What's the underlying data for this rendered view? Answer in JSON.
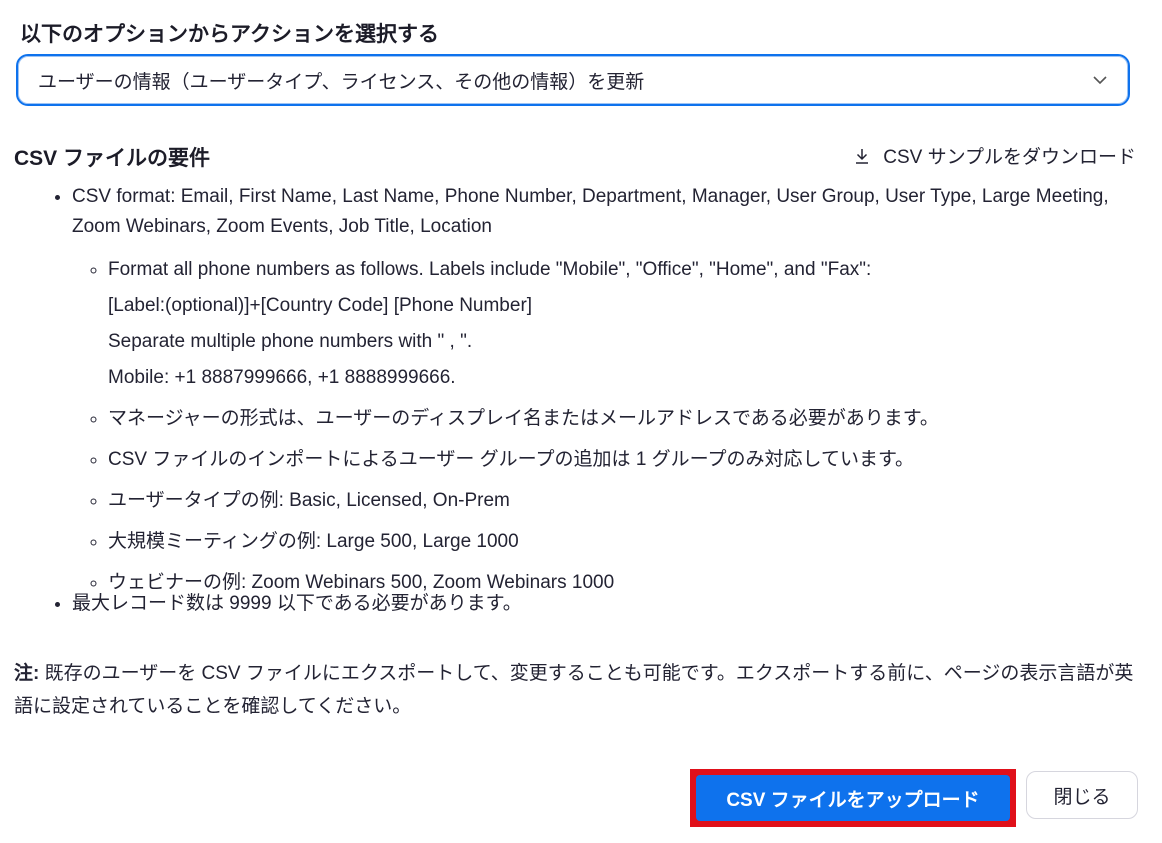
{
  "action": {
    "label": "以下のオプションからアクションを選択する",
    "selected": "ユーザーの情報（ユーザータイプ、ライセンス、その他の情報）を更新"
  },
  "requirements": {
    "title": "CSV ファイルの要件",
    "download_label": "CSV サンプルをダウンロード",
    "csv_format": "CSV format: Email, First Name, Last Name, Phone Number, Department, Manager, User Group, User Type, Large Meeting, Zoom Webinars, Zoom Events, Job Title, Location",
    "phone_lines": [
      "Format all phone numbers as follows. Labels include \"Mobile\", \"Office\", \"Home\", and \"Fax\":",
      "[Label:(optional)]+[Country Code] [Phone Number]",
      "Separate multiple phone numbers with \" , \".",
      "Mobile: +1 8887999666, +1 8888999666."
    ],
    "sub_items": [
      "マネージャーの形式は、ユーザーのディスプレイ名またはメールアドレスである必要があります。",
      "CSV ファイルのインポートによるユーザー グループの追加は 1 グループのみ対応しています。",
      "ユーザータイプの例: Basic, Licensed, On-Prem",
      "大規模ミーティングの例: Large 500, Large 1000",
      "ウェビナーの例: Zoom Webinars 500, Zoom Webinars 1000"
    ],
    "max_records": "最大レコード数は 9999 以下である必要があります。"
  },
  "note": {
    "prefix": "注:",
    "text": " 既存のユーザーを CSV ファイルにエクスポートして、変更することも可能です。エクスポートする前に、ページの表示言語が英語に設定されていることを確認してください。"
  },
  "buttons": {
    "upload": "CSV ファイルをアップロード",
    "close": "閉じる"
  },
  "colors": {
    "primary": "#0e72ed",
    "highlight_border": "#e0101a",
    "text": "#232333"
  },
  "icons": {
    "select": "chevron-down-icon",
    "download": "download-icon"
  }
}
